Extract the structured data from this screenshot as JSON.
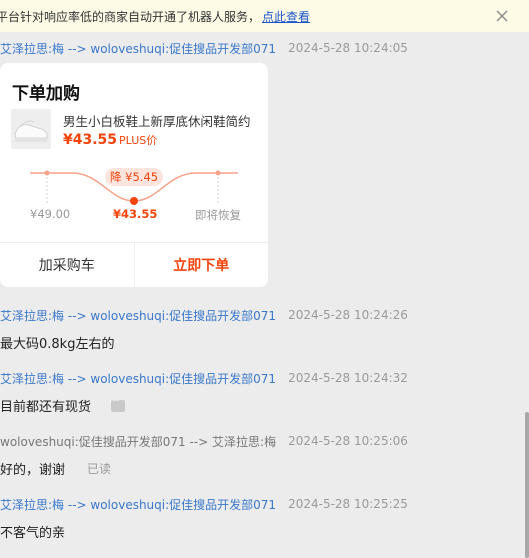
{
  "notice": {
    "text": "平台针对响应率低的商家自动开通了机器人服务，",
    "link": "点此查看",
    "close_icon": "close-icon"
  },
  "card": {
    "meta": {
      "sender": "艾泽拉思:梅 --> woloveshuqi:促佳搜品开发部071",
      "time": "2024-5-28 10:24:05"
    },
    "title": "下单加购",
    "product_name": "男生小白板鞋上新厚底休闲鞋简约",
    "product_price": "¥43.55",
    "plus_label": "PLUS价",
    "drop_badge": "降 ¥5.45",
    "price_left": "¥49.00",
    "price_mid": "¥43.55",
    "price_right": "即将恢复",
    "add_cart": "加采购车",
    "buy_now": "立即下单",
    "accent_color": "#f2440c"
  },
  "messages": [
    {
      "sender": "艾泽拉思:梅 --> woloveshuqi:促佳搜品开发部071",
      "time": "2024-5-28 10:24:26",
      "text": "最大码0.8kg左右的"
    },
    {
      "sender": "艾泽拉思:梅 --> woloveshuqi:促佳搜品开发部071",
      "time": "2024-5-28 10:24:32",
      "text": "目前都还有现货"
    },
    {
      "sender": "woloveshuqi:促佳搜品开发部071 --> 艾泽拉思:梅",
      "time": "2024-5-28 10:25:06",
      "text": "好的，谢谢",
      "status": "已读"
    },
    {
      "sender": "艾泽拉思:梅 --> woloveshuqi:促佳搜品开发部071",
      "time": "2024-5-28 10:25:25",
      "text": "不客气的亲"
    }
  ]
}
